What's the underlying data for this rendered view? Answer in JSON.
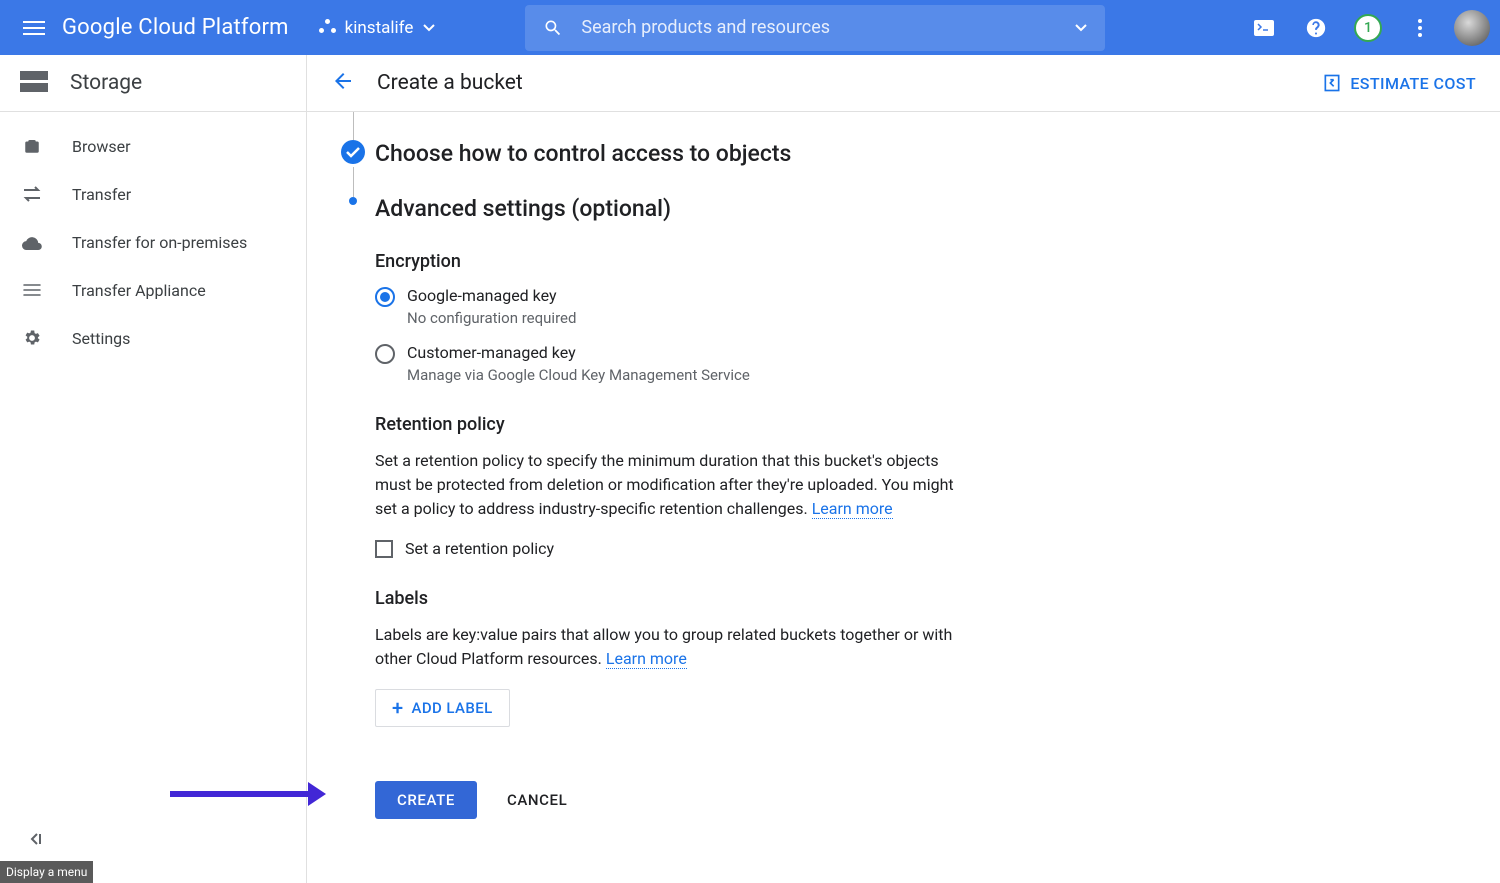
{
  "header": {
    "logo": "Google Cloud Platform",
    "project": "kinstalife",
    "search_placeholder": "Search products and resources",
    "badge_count": "1"
  },
  "sidebar": {
    "title": "Storage",
    "items": [
      {
        "label": "Browser"
      },
      {
        "label": "Transfer"
      },
      {
        "label": "Transfer for on-premises"
      },
      {
        "label": "Transfer Appliance"
      },
      {
        "label": "Settings"
      }
    ],
    "tooltip": "Display a menu"
  },
  "main": {
    "page_title": "Create a bucket",
    "estimate_label": "ESTIMATE COST",
    "step_access_title": "Choose how to control access to objects",
    "step_advanced_title": "Advanced settings (optional)",
    "encryption": {
      "heading": "Encryption",
      "opt1": "Google-managed key",
      "opt1_sub": "No configuration required",
      "opt2": "Customer-managed key",
      "opt2_sub": "Manage via Google Cloud Key Management Service"
    },
    "retention": {
      "heading": "Retention policy",
      "desc": "Set a retention policy to specify the minimum duration that this bucket's objects must be protected from deletion or modification after they're uploaded. You might set a policy to address industry-specific retention challenges. ",
      "learn_more": "Learn more",
      "checkbox_label": "Set a retention policy"
    },
    "labels": {
      "heading": "Labels",
      "desc": "Labels are key:value pairs that allow you to group related buckets together or with other Cloud Platform resources. ",
      "learn_more": "Learn more",
      "add_label": "ADD LABEL"
    },
    "create_btn": "CREATE",
    "cancel_btn": "CANCEL"
  }
}
